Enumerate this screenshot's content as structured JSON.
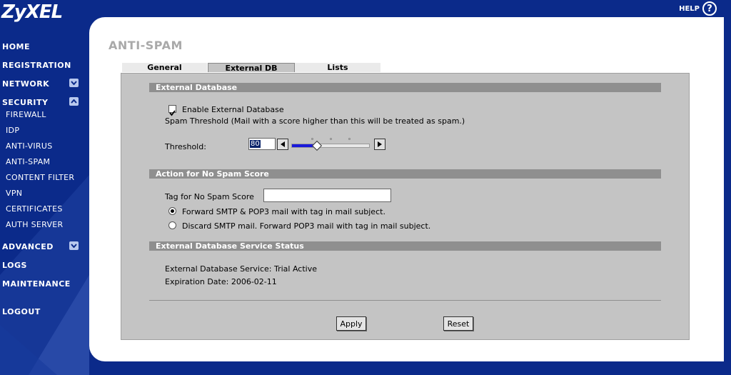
{
  "brand": {
    "logo": "ZyXEL"
  },
  "header": {
    "help_label": "HELP",
    "help_glyph": "?"
  },
  "sidebar": {
    "items": [
      {
        "label": "HOME",
        "level": "top"
      },
      {
        "label": "REGISTRATION",
        "level": "top"
      },
      {
        "label": "NETWORK",
        "level": "top",
        "chevron": true
      },
      {
        "label": "SECURITY",
        "level": "top",
        "chevron": true,
        "expanded": true
      },
      {
        "label": "FIREWALL",
        "level": "sub"
      },
      {
        "label": "IDP",
        "level": "sub"
      },
      {
        "label": "ANTI-VIRUS",
        "level": "sub"
      },
      {
        "label": "ANTI-SPAM",
        "level": "sub"
      },
      {
        "label": "CONTENT FILTER",
        "level": "sub"
      },
      {
        "label": "VPN",
        "level": "sub"
      },
      {
        "label": "CERTIFICATES",
        "level": "sub"
      },
      {
        "label": "AUTH SERVER",
        "level": "sub"
      },
      {
        "label": "ADVANCED",
        "level": "top",
        "chevron": true
      },
      {
        "label": "LOGS",
        "level": "top"
      },
      {
        "label": "MAINTENANCE",
        "level": "top"
      },
      {
        "label": "LOGOUT",
        "level": "top"
      }
    ]
  },
  "page": {
    "title": "ANTI-SPAM",
    "tabs": [
      {
        "label": "General"
      },
      {
        "label": "External DB",
        "active": true
      },
      {
        "label": "Lists"
      }
    ]
  },
  "external_db": {
    "header": "External Database",
    "enable_label": "Enable External Database",
    "enabled": true,
    "threshold_desc": "Spam Threshold (Mail with a score higher than this will be treated as spam.)",
    "threshold_label": "Threshold:",
    "threshold_value": "80",
    "slider_fraction": 0.33
  },
  "no_score": {
    "header": "Action for No Spam Score",
    "tag_label": "Tag for No Spam Score",
    "tag_value": "",
    "option_forward": "Forward SMTP & POP3 mail with tag in mail subject.",
    "option_discard": "Discard SMTP mail. Forward POP3 mail with tag in mail subject.",
    "selected": "forward"
  },
  "status": {
    "header": "External Database Service Status",
    "service_line": "External Database Service: Trial Active",
    "expiration_line": "Expiration Date: 2006-02-11"
  },
  "buttons": {
    "apply": "Apply",
    "reset": "Reset"
  },
  "colors": {
    "navy": "#0b2a8a",
    "panel": "#c4c4c4",
    "section": "#8f8f8f",
    "slider": "#1a1adb"
  }
}
